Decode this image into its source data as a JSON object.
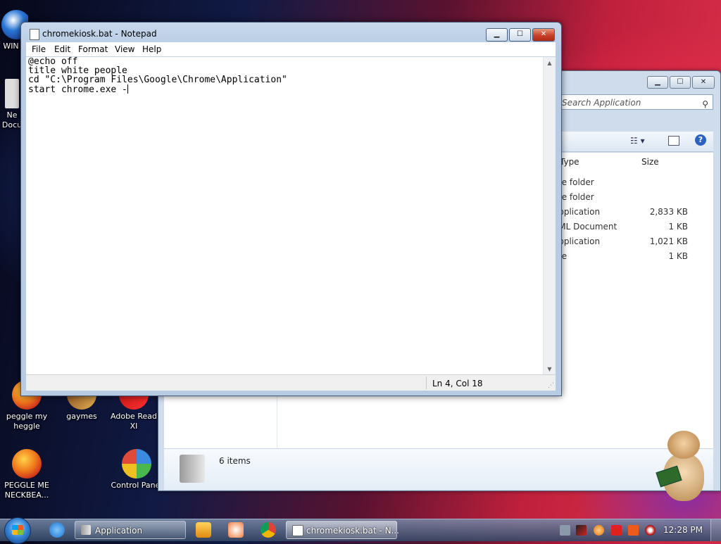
{
  "desktop": {
    "icons": [
      {
        "label": "WIN V",
        "name": "desktop-icon-win"
      },
      {
        "label": "Ne Docu",
        "name": "desktop-icon-new-document"
      },
      {
        "label": "peggle my heggle",
        "name": "desktop-icon-peggle-my-heggle"
      },
      {
        "label": "gaymes",
        "name": "desktop-icon-gaymes"
      },
      {
        "label": "Adobe Read XI",
        "name": "desktop-icon-adobe-reader"
      },
      {
        "label": "PEGGLE ME NECKBEA...",
        "name": "desktop-icon-peggle-me"
      },
      {
        "label": "Control Panel",
        "name": "desktop-icon-control-panel"
      }
    ]
  },
  "explorer": {
    "search_placeholder": "Search Application",
    "columns": {
      "type": "Type",
      "size": "Size"
    },
    "files": [
      {
        "type": "File folder",
        "size": ""
      },
      {
        "type": "File folder",
        "size": ""
      },
      {
        "type": "Application",
        "size": "2,833 KB"
      },
      {
        "type": "XML Document",
        "size": "1 KB"
      },
      {
        "type": "Application",
        "size": "1,021 KB"
      },
      {
        "type": "File",
        "size": "1 KB"
      }
    ],
    "item_count": "6 items"
  },
  "notepad": {
    "title": "chromekiosk.bat - Notepad",
    "menu": [
      "File",
      "Edit",
      "Format",
      "View",
      "Help"
    ],
    "lines": [
      "@echo off",
      "title white people",
      "cd \"C:\\Program Files\\Google\\Chrome\\Application\"",
      "start chrome.exe -"
    ],
    "status": "Ln 4, Col 18",
    "buttons": {
      "minimize": "▁",
      "maximize": "☐",
      "close": "✕"
    }
  },
  "taskbar": {
    "buttons": [
      {
        "label": "Application",
        "name": "taskbar-explorer-application"
      },
      {
        "label": "chromekiosk.bat - N...",
        "name": "taskbar-notepad-chromekiosk"
      }
    ],
    "clock": "12:28 PM"
  },
  "colors": {
    "accent": "#3a88d8",
    "close_red": "#c8402a",
    "window_frame": "#b7cbe3"
  }
}
